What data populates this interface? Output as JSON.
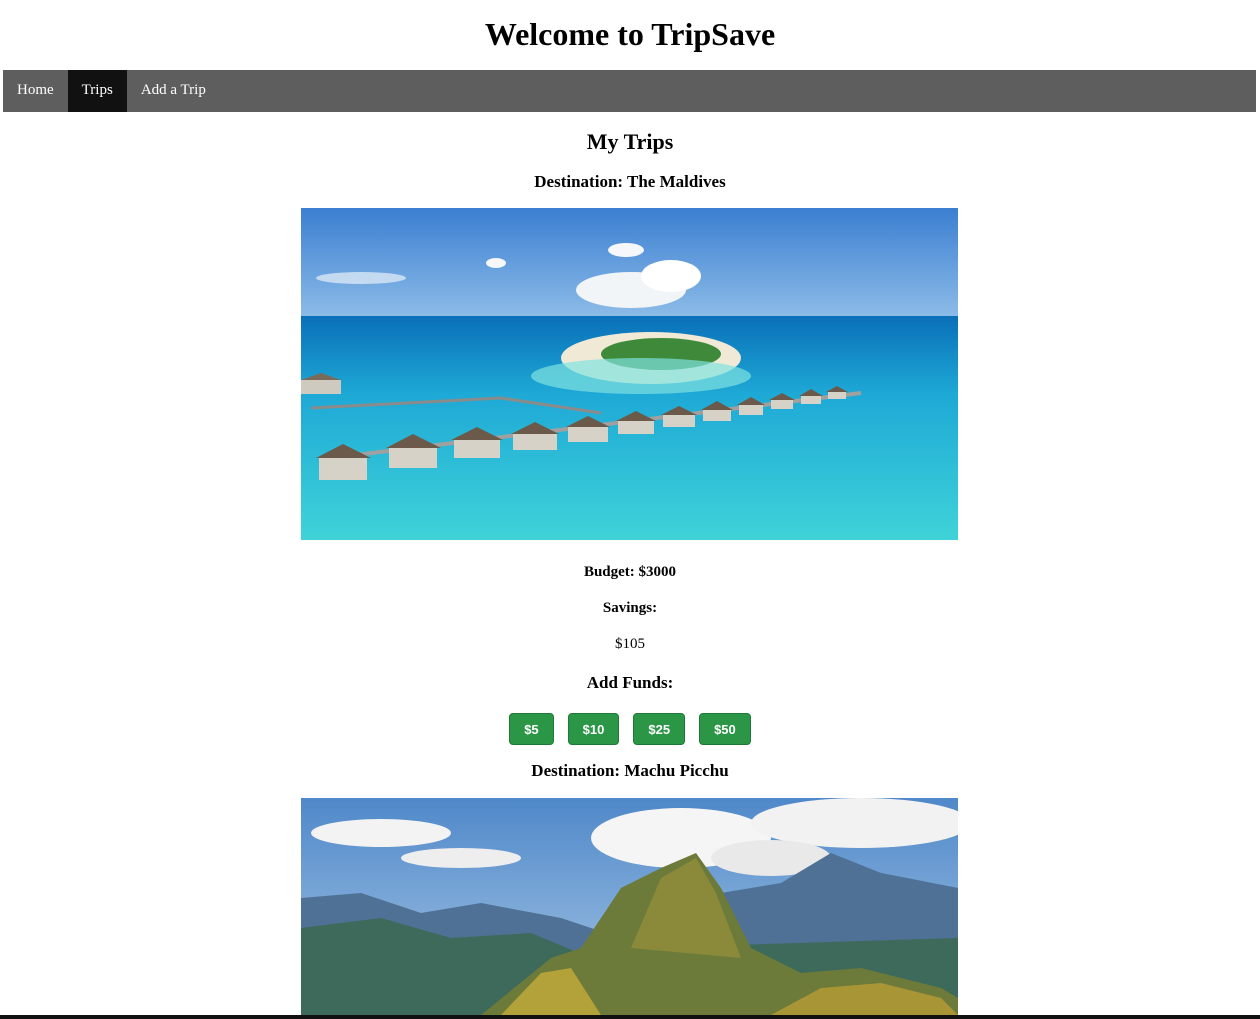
{
  "header": {
    "title": "Welcome to TripSave"
  },
  "nav": {
    "items": [
      {
        "label": "Home",
        "active": false
      },
      {
        "label": "Trips",
        "active": true
      },
      {
        "label": "Add a Trip",
        "active": false
      }
    ]
  },
  "page": {
    "title": "My Trips"
  },
  "trips": [
    {
      "destination": "Destination: The Maldives",
      "image": "maldives-overwater-villas-photo",
      "budget": "Budget: $3000",
      "savings_label": "Savings:",
      "savings_value": "$105",
      "add_funds_label": "Add Funds:",
      "fund_buttons": [
        "$5",
        "$10",
        "$25",
        "$50"
      ]
    },
    {
      "destination": "Destination: Machu Picchu",
      "image": "machu-picchu-mountains-photo"
    }
  ],
  "colors": {
    "navbar_bg": "#5e5e5e",
    "nav_active_bg": "#111111",
    "fund_button_bg": "#2a9646"
  }
}
